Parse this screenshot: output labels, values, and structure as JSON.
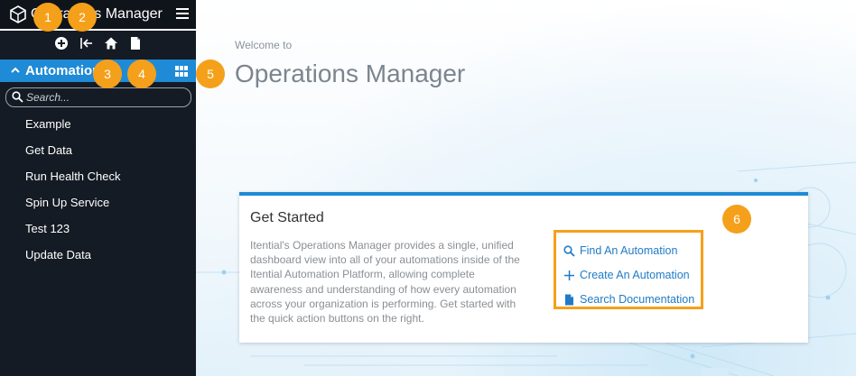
{
  "app": {
    "title": "Operations Manager",
    "accent_color": "#1f8ad6",
    "callout_color": "#f5a01a"
  },
  "sidebar": {
    "toolbar_icons": [
      "add-circle-icon",
      "import-icon",
      "home-icon",
      "document-icon"
    ],
    "collection": {
      "label": "Automation",
      "icon": "grid-icon"
    },
    "search": {
      "placeholder": "Search..."
    },
    "items": [
      {
        "label": "Example"
      },
      {
        "label": "Get Data"
      },
      {
        "label": "Run Health Check"
      },
      {
        "label": "Spin Up Service"
      },
      {
        "label": "Test 123"
      },
      {
        "label": "Update Data"
      }
    ]
  },
  "main": {
    "welcome": "Welcome to",
    "title": "Operations Manager",
    "card": {
      "title": "Get Started",
      "body": "Itential's Operations Manager provides a single, unified dashboard view into all of your automations inside of the Itential Automation Platform, allowing complete awareness and understanding of how every automation across your organization is performing. Get started with the quick action buttons on the right.",
      "actions": [
        {
          "label": "Find An Automation",
          "icon": "search-icon"
        },
        {
          "label": "Create An Automation",
          "icon": "plus-icon"
        },
        {
          "label": "Search Documentation",
          "icon": "document-icon"
        }
      ]
    }
  },
  "callouts": [
    "1",
    "2",
    "3",
    "4",
    "5",
    "6"
  ]
}
